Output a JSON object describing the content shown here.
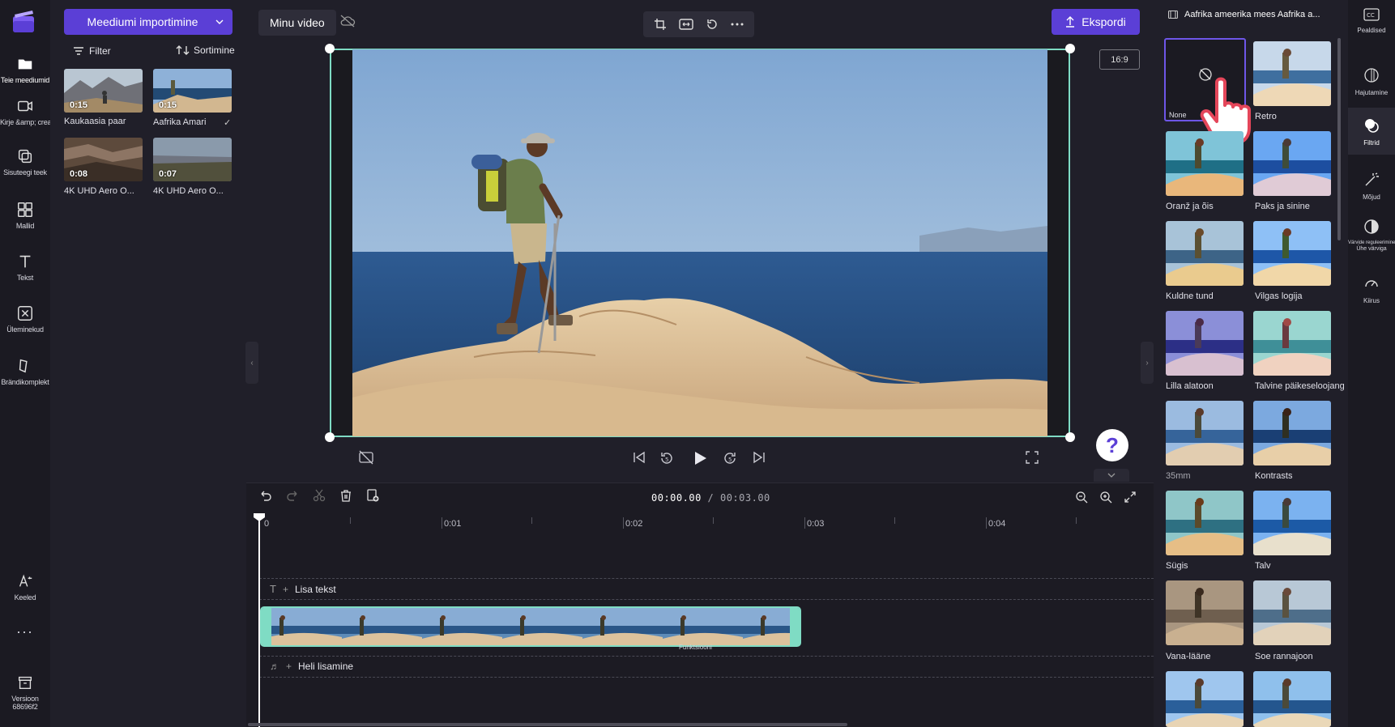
{
  "left_rail": {
    "items": [
      {
        "label": "Teie meediumid"
      },
      {
        "label": "Kirje &amp; create"
      },
      {
        "label": "Sisuteegi teek"
      },
      {
        "label": "Mallid"
      },
      {
        "label": "Tekst"
      },
      {
        "label": "Üleminekud"
      },
      {
        "label": "Brändikomplekt"
      }
    ],
    "languages": "Keeled",
    "more": "...",
    "version_label": "Versioon",
    "version_value": "68696f2"
  },
  "media": {
    "import_label": "Meediumi importimine",
    "filter_label": "Filter",
    "sort_label": "Sortimine",
    "items": [
      {
        "duration": "0:15",
        "name": "Kaukaasia paar"
      },
      {
        "duration": "0:15",
        "name": "Aafrika Amari",
        "status": "✓"
      },
      {
        "duration": "0:08",
        "name": "4K UHD Aero O..."
      },
      {
        "duration": "0:07",
        "name": "4K UHD Aero O..."
      }
    ]
  },
  "topbar": {
    "project_name": "Minu video",
    "export_label": "Ekspordi",
    "aspect_ratio": "16:9"
  },
  "playback": {
    "current_time": "00:00.00",
    "total_time": "/ 00:03.00",
    "help": "?"
  },
  "timeline": {
    "ruler": [
      "0",
      "0:01",
      "0:02",
      "0:03",
      "0:04"
    ],
    "text_track": "Lisa tekst",
    "audio_track": "Heli lisamine",
    "clip_caption": "Funktsiooni"
  },
  "filters_panel": {
    "title": "Aafrika ameerika mees Aafrika a...",
    "filters": [
      {
        "name": "None",
        "selected": true
      },
      {
        "name": "Retro"
      },
      {
        "name": "Oranž ja õis"
      },
      {
        "name": "Paks ja sinine"
      },
      {
        "name": "Kuldne tund"
      },
      {
        "name": "Vilgas logija"
      },
      {
        "name": "Lilla alatoon"
      },
      {
        "name": "Talvine päikeseloojang"
      },
      {
        "name": "35mm"
      },
      {
        "name": "Kontrasts"
      },
      {
        "name": "Sügis"
      },
      {
        "name": "Talv"
      },
      {
        "name": "Vana-lääne"
      },
      {
        "name": "Soe rannajoon"
      }
    ]
  },
  "right_rail": {
    "items": [
      {
        "label": "Pealdised"
      },
      {
        "label": "Hajutamine"
      },
      {
        "label": "Filtrid"
      },
      {
        "label": "Mõjud"
      },
      {
        "label": "Värvide reguleerimine"
      },
      {
        "label": "Ühe värviga"
      },
      {
        "label": "Kiirus"
      }
    ]
  },
  "colors": {
    "accent": "#5b3fd6",
    "selection": "#7fdcc4"
  }
}
